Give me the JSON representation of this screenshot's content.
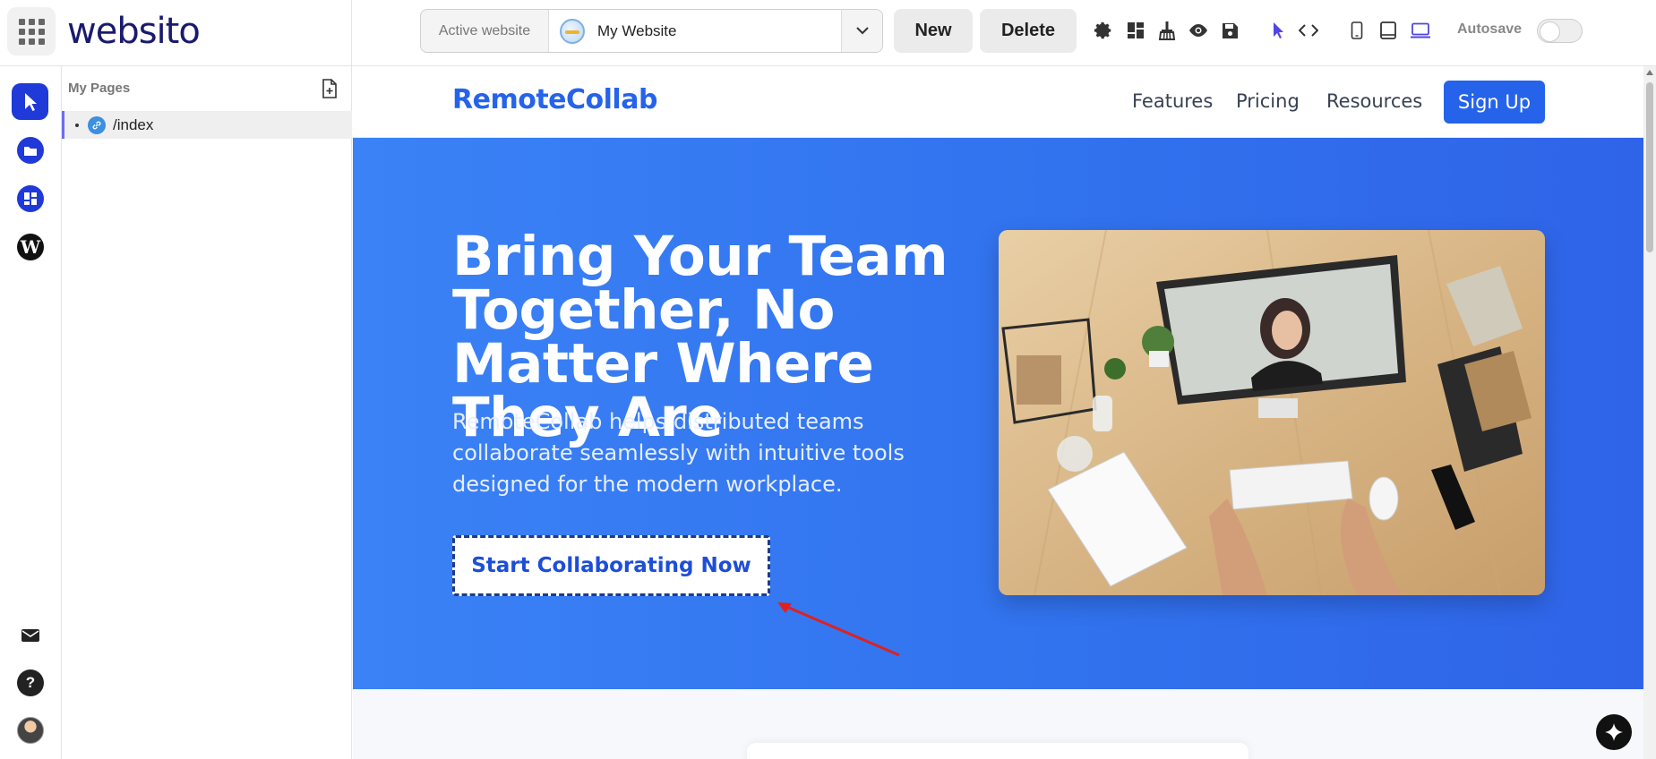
{
  "app": {
    "logo": "websito",
    "active_website_label": "Active website",
    "active_website_value": "My Website",
    "new_label": "New",
    "delete_label": "Delete",
    "autosave_label": "Autosave",
    "autosave_on": false
  },
  "pages_panel": {
    "title": "My Pages",
    "pages": [
      {
        "path": "/index",
        "selected": true
      }
    ]
  },
  "site": {
    "brand": "RemoteCollab",
    "nav": [
      "Features",
      "Pricing",
      "Resources"
    ],
    "signup": "Sign Up",
    "hero_title": "Bring Your Team Together, No Matter Where They Are",
    "hero_subtitle": "RemoteCollab helps distributed teams collaborate seamlessly with intuitive tools designed for the modern workplace.",
    "cta": "Start Collaborating Now"
  },
  "colors": {
    "brand_blue": "#2563eb",
    "rail_active": "#1f3ad8",
    "hero_gradient_start": "#3b82f6",
    "hero_gradient_end": "#2f64e8"
  },
  "icons": {
    "toolbar": [
      "gear-icon",
      "blocks-icon",
      "broom-icon",
      "eye-icon",
      "save-icon",
      "cursor-icon",
      "code-icon",
      "mobile-icon",
      "tablet-icon",
      "desktop-icon"
    ],
    "rail": [
      "cursor-icon",
      "folder-icon",
      "dashboard-icon",
      "wordpress-icon",
      "mail-icon",
      "help-icon",
      "avatar"
    ]
  }
}
